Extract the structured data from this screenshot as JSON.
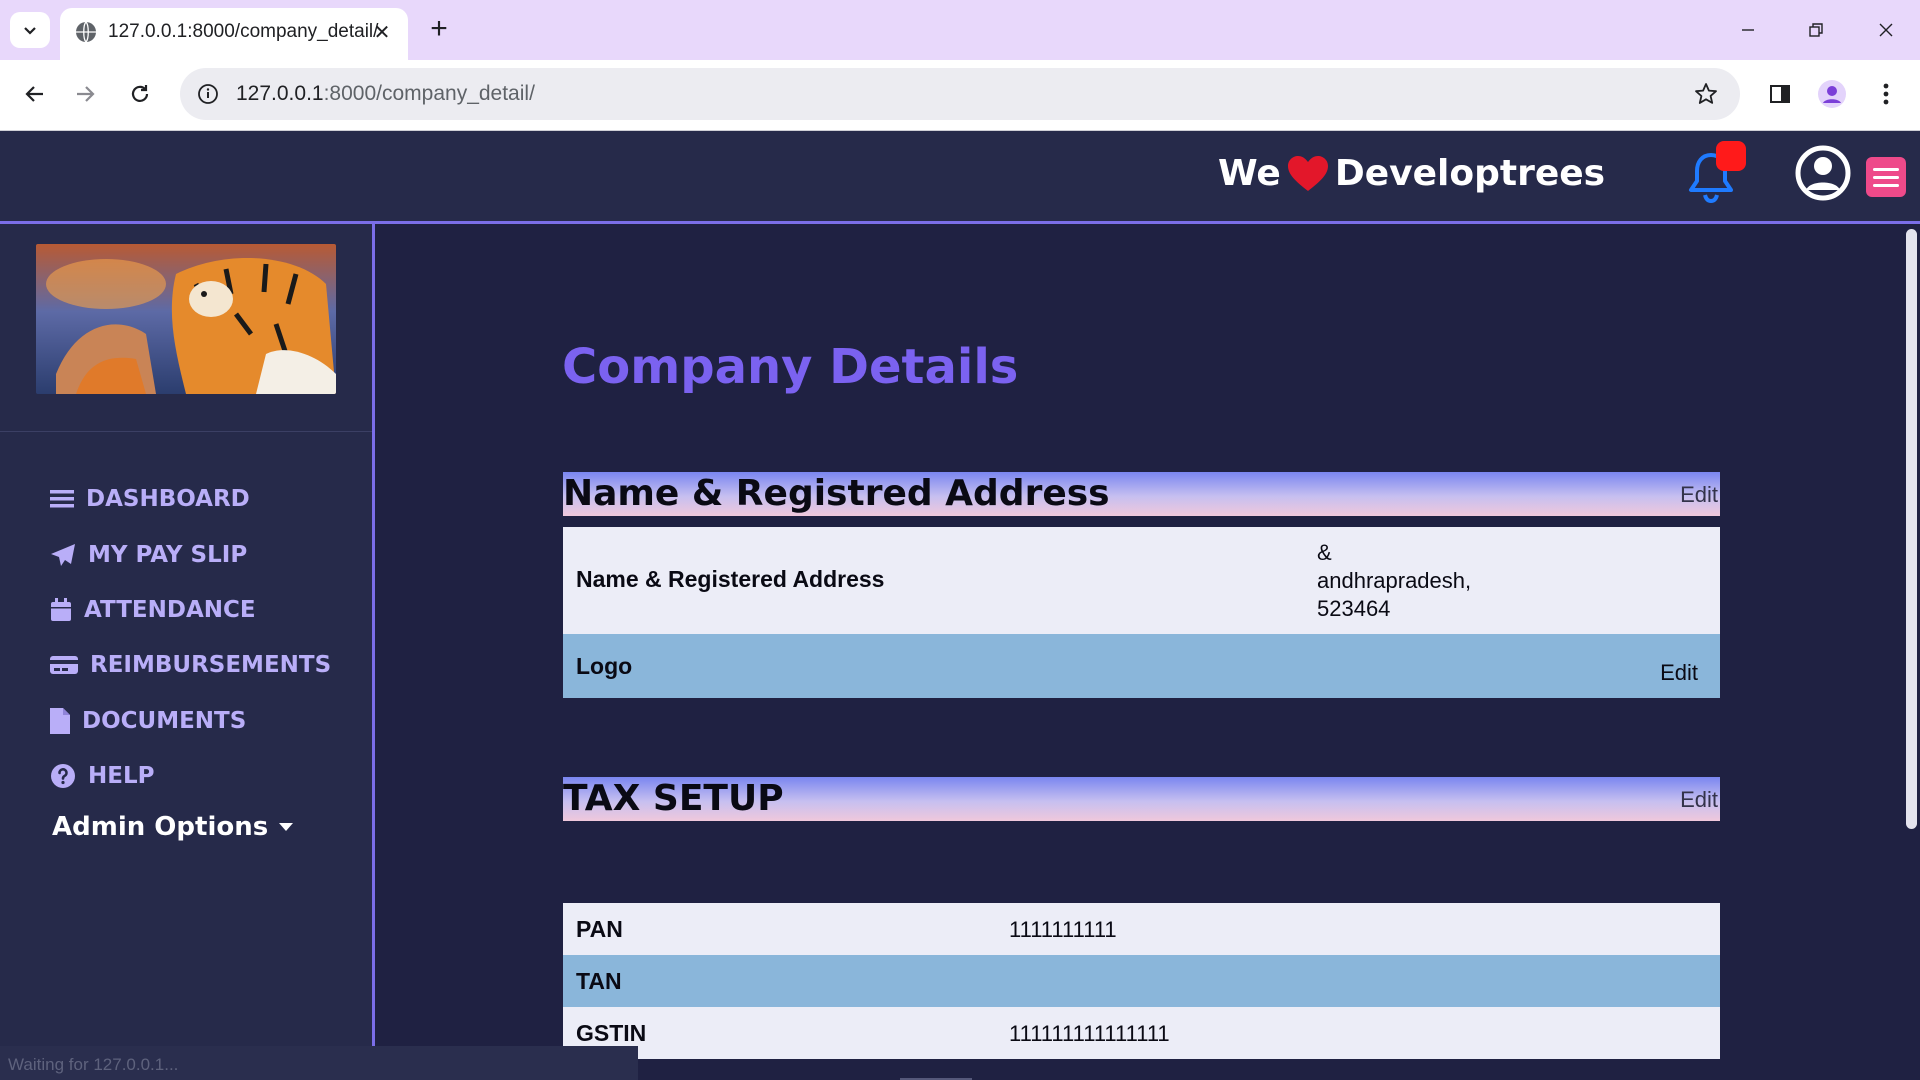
{
  "browser": {
    "tab_title": "127.0.0.1:8000/company_detail/",
    "url_host": "127.0.0.1",
    "url_path": ":8000/company_detail/",
    "status_text": "Waiting for 127.0.0.1..."
  },
  "header": {
    "brand_before": "We",
    "brand_after": "Developtrees"
  },
  "sidebar": {
    "items": [
      {
        "label": "DASHBOARD",
        "icon": "bars-icon"
      },
      {
        "label": "MY PAY SLIP",
        "icon": "paper-plane-icon"
      },
      {
        "label": "ATTENDANCE",
        "icon": "calendar-icon"
      },
      {
        "label": "REIMBURSEMENTS",
        "icon": "credit-card-icon"
      },
      {
        "label": "DOCUMENTS",
        "icon": "file-icon"
      },
      {
        "label": "HELP",
        "icon": "question-circle-icon"
      }
    ],
    "admin_options": "Admin Options"
  },
  "main": {
    "title": "Company Details",
    "section1": {
      "title": "Name & Registred Address",
      "edit": "Edit",
      "rows": [
        {
          "label": "Name & Registered Address",
          "value": "&\nandhrapradesh,\n523464"
        },
        {
          "label": "Logo",
          "edit": "Edit"
        }
      ]
    },
    "section2": {
      "title": "TAX SETUP",
      "edit": "Edit",
      "rows": [
        {
          "label": "PAN",
          "value": "1111111111"
        },
        {
          "label": "TAN",
          "value": ""
        },
        {
          "label": "GSTIN",
          "value": "111111111111111"
        }
      ]
    }
  },
  "colors": {
    "page_bg": "#1f2142",
    "nav_bg": "#262a4a",
    "accent": "#7b6ee8",
    "title": "#7b62f0",
    "sidebar_text": "#b9aef8",
    "row_light": "#ecedf7",
    "row_blue": "#8ab6da",
    "badge": "#ff1a1a",
    "menu_button": "#ee4a8a"
  }
}
